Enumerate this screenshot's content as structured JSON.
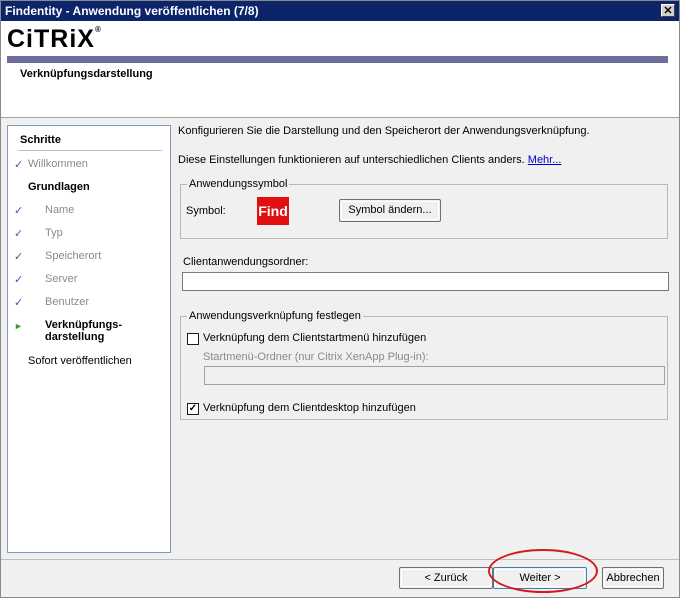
{
  "window": {
    "title": "Findentity - Anwendung veröffentlichen (7/8)",
    "close_glyph": "✕"
  },
  "header": {
    "logo": "CiTRiX",
    "logo_mark": "®",
    "title": "Verknüpfungsdarstellung"
  },
  "sidebar": {
    "heading": "Schritte",
    "check_glyph": "✓",
    "arrow_glyph": "►",
    "items": {
      "willkommen": "Willkommen",
      "grundlagen": "Grundlagen",
      "name": "Name",
      "typ": "Typ",
      "speicherort": "Speicherort",
      "server": "Server",
      "benutzer": "Benutzer",
      "verknuepfung_1": "Verknüpfungs-",
      "verknuepfung_2": "darstellung",
      "sofort": "Sofort veröffentlichen"
    }
  },
  "main": {
    "intro": "Konfigurieren Sie die Darstellung und den Speicherort der Anwendungsverknüpfung.",
    "info": "Diese Einstellungen funktionieren auf unterschiedlichen Clients anders.",
    "more_link": "Mehr...",
    "icon_group": {
      "title": "Anwendungssymbol",
      "symbol_label": "Symbol:",
      "icon_text": "Find",
      "change_button": "Symbol ändern..."
    },
    "client_folder": {
      "label": "Clientanwendungsordner:",
      "value": ""
    },
    "shortcut_group": {
      "title": "Anwendungsverknüpfung festlegen",
      "startmenu_label": "Verknüpfung dem Clientstartmenü hinzufügen",
      "startmenu_checked": false,
      "startmenu_folder_label": "Startmenü-Ordner (nur Citrix XenApp Plug-in):",
      "startmenu_folder_value": "",
      "desktop_label": "Verknüpfung dem Clientdesktop hinzufügen",
      "desktop_checked": true,
      "check_mark": "✓"
    }
  },
  "footer": {
    "back": "< Zurück",
    "next": "Weiter >",
    "cancel": "Abbrechen"
  },
  "colors": {
    "titlebar": "#0b246a",
    "accent_bar": "#6e6e9a",
    "annotation": "#d21a1a",
    "icon": "#e01010"
  }
}
